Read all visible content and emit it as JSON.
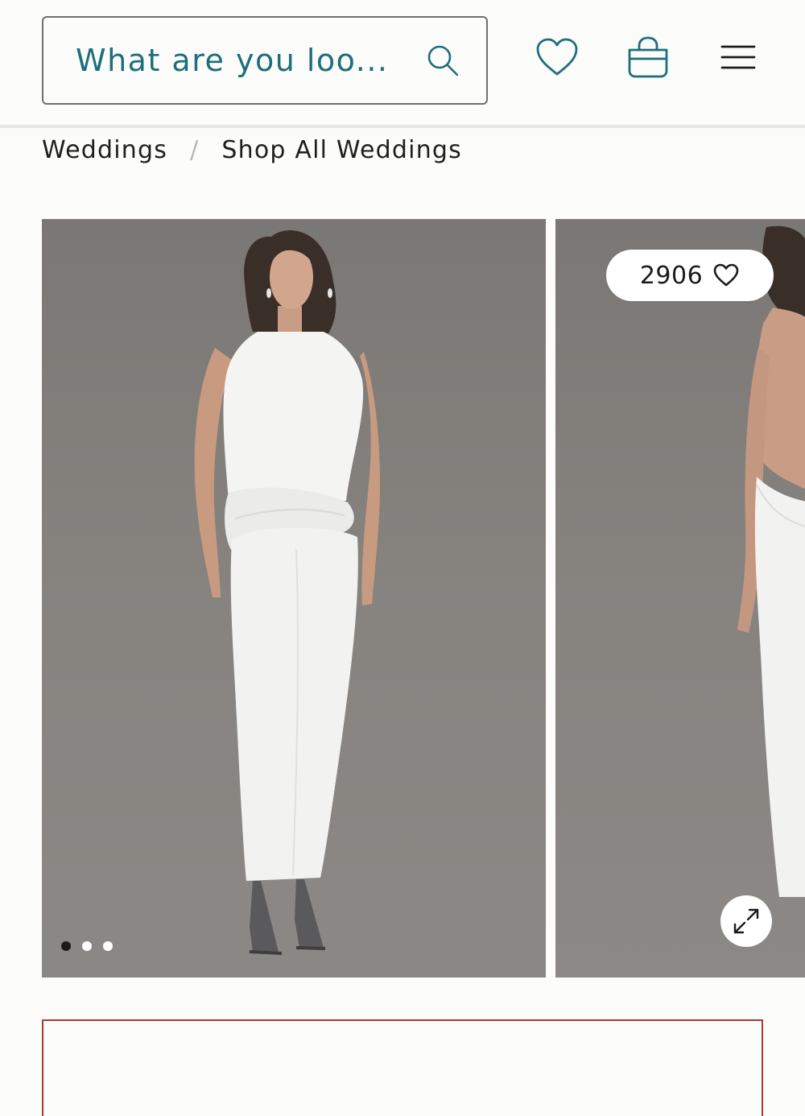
{
  "header": {
    "search": {
      "placeholder": "What are you loo..."
    },
    "icons": [
      "search-icon",
      "heart-icon",
      "shopping-bag-icon",
      "hamburger-menu-icon"
    ],
    "accent_color": "#1d6f7c"
  },
  "breadcrumb": {
    "items": [
      {
        "label": "Weddings"
      },
      {
        "label": "Shop All Weddings"
      }
    ],
    "separator": "/"
  },
  "gallery": {
    "likes_count": "2906",
    "likes_icon": "heart-outline-icon",
    "expand_icon": "expand-arrows-icon",
    "slide_count": 3,
    "active_slide_index": 0
  },
  "promo_box": {
    "border_color": "#b0343a"
  }
}
